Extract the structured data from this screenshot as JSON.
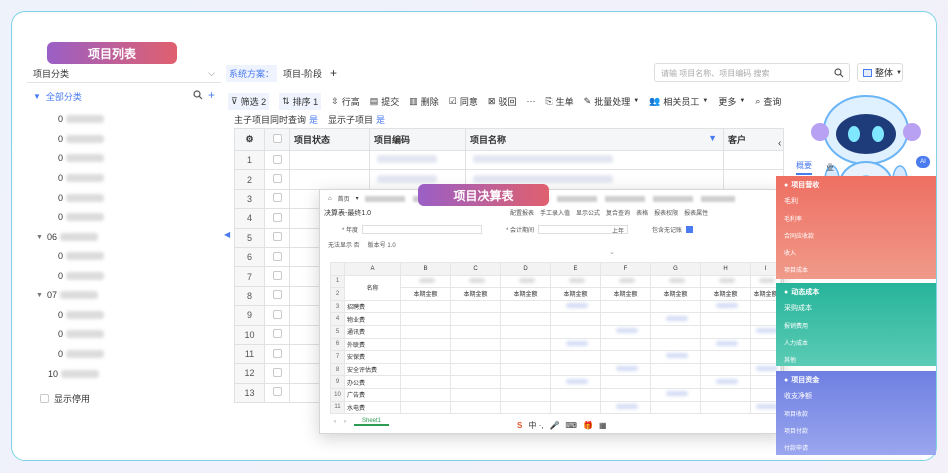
{
  "colors": {
    "accent": "#4a7bf0",
    "frame_border": "#7fd3e6",
    "pill_start": "#9a5fc6",
    "pill_end": "#e0606e",
    "card1": "#ec6f66",
    "card2": "#2fb39c",
    "card3": "#6f7fe0"
  },
  "labels": {
    "project_list": "项目列表",
    "project_budget": "项目决算表"
  },
  "left": {
    "category_select": "项目分类",
    "tree_root": "全部分类",
    "items": [
      {
        "prefix": "0"
      },
      {
        "prefix": "0"
      },
      {
        "prefix": "0"
      },
      {
        "prefix": "0"
      },
      {
        "prefix": "0"
      },
      {
        "prefix": "0"
      },
      {
        "prefix": "06"
      },
      {
        "prefix": "0"
      },
      {
        "prefix": "0"
      },
      {
        "prefix": "07"
      },
      {
        "prefix": "0"
      },
      {
        "prefix": "0"
      },
      {
        "prefix": "0"
      },
      {
        "prefix": "10"
      }
    ],
    "show_disabled": "显示停用"
  },
  "header": {
    "scheme_label": "系统方案：",
    "scheme_value": "项目-阶段",
    "add": "+",
    "search_placeholder": "请输 项目名称、项目编码 搜索",
    "layout_label": "整体"
  },
  "toolbar": {
    "filter": "筛选 2",
    "sort": "排序 1",
    "row_height": "行高",
    "submit": "提交",
    "delete": "删除",
    "agree": "同意",
    "reject": "驳回",
    "more_dots": "···",
    "generate": "生单",
    "batch": "批量处理",
    "staff": "相关员工",
    "more": "更多",
    "query": "查询"
  },
  "subbar": {
    "sync_query": "主子项目同时查询",
    "sync_query_val": "是",
    "show_child": "显示子项目",
    "show_child_val": "是"
  },
  "table": {
    "headers": [
      "项目状态",
      "项目编码",
      "项目名称",
      "客户"
    ],
    "rows": [
      "1",
      "2",
      "3",
      "4",
      "5",
      "6",
      "7",
      "8",
      "9",
      "10",
      "11",
      "12",
      "13"
    ]
  },
  "sheet": {
    "tabs": [
      "首页",
      "决算表-最终1.0"
    ],
    "title": "决算表-最终1.0",
    "buttons": [
      "配置报表",
      "手工录入值",
      "显示公式",
      "复合查询",
      "表格",
      "报表权限",
      "报表属性"
    ],
    "filter_label_1": "* 年度",
    "filter_label_2": "* 会计期间",
    "filter_val_2": "上年",
    "filter_label_3": "包含无记账",
    "show_notes": "无法显示 否",
    "version": "版本号 1.0",
    "col_letters": [
      "A",
      "B",
      "C",
      "D",
      "E",
      "F",
      "G",
      "H",
      "I"
    ],
    "header_name": "名称",
    "period_label": "本期金额",
    "rows": [
      {
        "n": "1",
        "name": ""
      },
      {
        "n": "2",
        "name": ""
      },
      {
        "n": "3",
        "name": "招聘费"
      },
      {
        "n": "4",
        "name": "物业费"
      },
      {
        "n": "5",
        "name": "通讯费"
      },
      {
        "n": "6",
        "name": "外联费"
      },
      {
        "n": "7",
        "name": "安保费"
      },
      {
        "n": "8",
        "name": "安全评估费"
      },
      {
        "n": "9",
        "name": "办公费"
      },
      {
        "n": "10",
        "name": "广告费"
      },
      {
        "n": "11",
        "name": "水电费"
      }
    ],
    "sheet_tab": "Sheet1",
    "ime_bar": "中 ·,"
  },
  "right": {
    "tabs": [
      "概要",
      "业"
    ],
    "badge": "AI",
    "cards": [
      {
        "title": "项目营收",
        "items": [
          "毛利",
          "毛利率",
          "合同应收款",
          "收入",
          "项目成本"
        ]
      },
      {
        "title": "动态成本",
        "items": [
          "采购成本",
          "报销费用",
          "人力成本",
          "其他"
        ]
      },
      {
        "title": "项目资金",
        "items": [
          "收支净额",
          "项目收款",
          "项目付款",
          "付款申请"
        ]
      }
    ]
  }
}
